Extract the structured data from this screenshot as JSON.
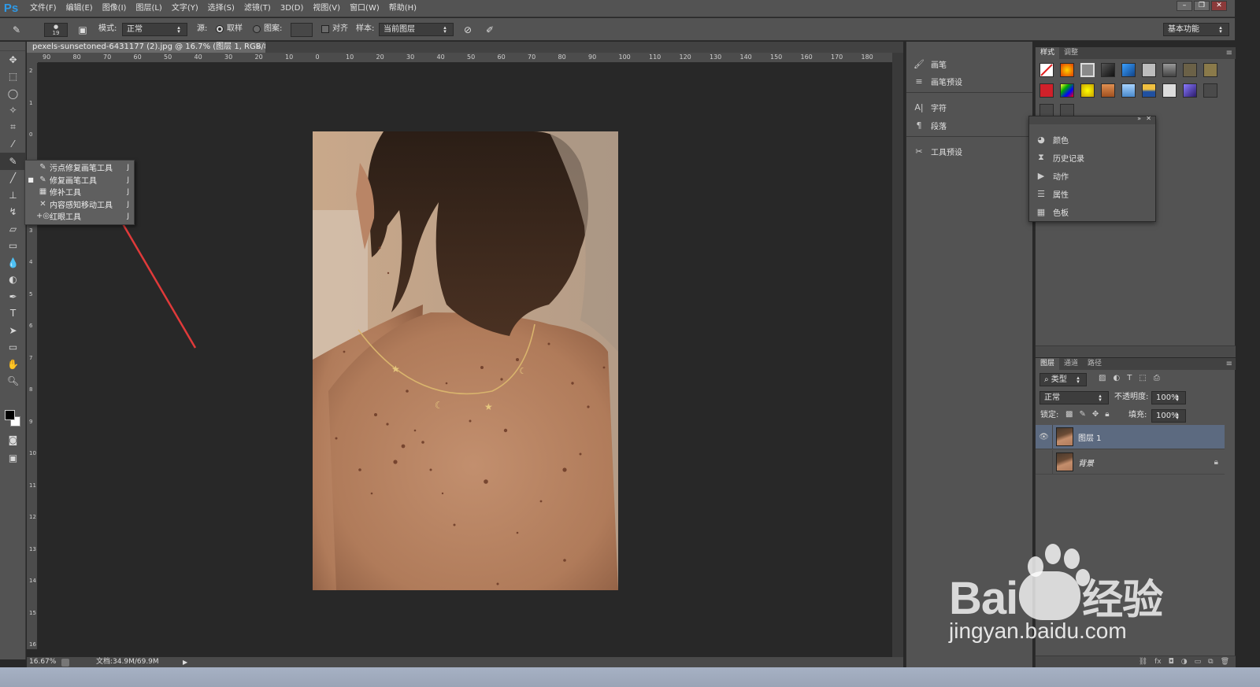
{
  "app": {
    "logo": "Ps"
  },
  "menu": [
    "文件(F)",
    "编辑(E)",
    "图像(I)",
    "图层(L)",
    "文字(Y)",
    "选择(S)",
    "滤镜(T)",
    "3D(D)",
    "视图(V)",
    "窗口(W)",
    "帮助(H)"
  ],
  "options": {
    "brush_size": "19",
    "mode_label": "模式:",
    "mode_value": "正常",
    "source_label": "源:",
    "sampled_label": "取样",
    "pattern_label": "图案:",
    "aligned_label": "对齐",
    "sample_label": "样本:",
    "sample_value": "当前图层",
    "workspace": "基本功能"
  },
  "document": {
    "tab_title": "pexels-sunsetoned-6431177 (2).jpg @ 16.7% (图层 1, RGB/8) *",
    "zoom": "16.67%",
    "doc_size": "文档:34.9M/69.9M"
  },
  "ruler": {
    "top_ticks": [
      "90",
      "80",
      "70",
      "60",
      "50",
      "40",
      "30",
      "20",
      "10",
      "0",
      "10",
      "20",
      "30",
      "40",
      "50",
      "60",
      "70",
      "80",
      "90",
      "100",
      "110",
      "120",
      "130",
      "140",
      "150",
      "160",
      "170",
      "180"
    ],
    "left_ticks": [
      "2",
      "1",
      "0",
      "1",
      "2",
      "3",
      "4",
      "5",
      "6",
      "7",
      "8",
      "9",
      "10",
      "11",
      "12",
      "13",
      "14",
      "15",
      "16"
    ]
  },
  "flyout": [
    {
      "label": "污点修复画笔工具",
      "key": "J",
      "icon": "spot-healing-icon",
      "active": false
    },
    {
      "label": "修复画笔工具",
      "key": "J",
      "icon": "healing-brush-icon",
      "active": true
    },
    {
      "label": "修补工具",
      "key": "J",
      "icon": "patch-icon",
      "active": false
    },
    {
      "label": "内容感知移动工具",
      "key": "J",
      "icon": "content-aware-move-icon",
      "active": false
    },
    {
      "label": "红眼工具",
      "key": "J",
      "icon": "red-eye-icon",
      "active": false
    }
  ],
  "panel_column": [
    {
      "label": "画笔",
      "icon": "brush-icon"
    },
    {
      "label": "画笔预设",
      "icon": "brush-presets-icon"
    },
    {
      "label": "字符",
      "icon": "character-icon"
    },
    {
      "label": "段落",
      "icon": "paragraph-icon"
    },
    {
      "label": "工具预设",
      "icon": "tool-presets-icon"
    }
  ],
  "styles_panel": {
    "tabs": [
      "样式",
      "调整"
    ]
  },
  "float_panel": [
    {
      "label": "颜色",
      "icon": "color-icon"
    },
    {
      "label": "历史记录",
      "icon": "history-icon"
    },
    {
      "label": "动作",
      "icon": "actions-icon"
    },
    {
      "label": "属性",
      "icon": "properties-icon"
    },
    {
      "label": "色板",
      "icon": "swatches-icon"
    }
  ],
  "layers_panel": {
    "tabs": [
      "图层",
      "通道",
      "路径"
    ],
    "filter_label": "类型",
    "blend_mode": "正常",
    "opacity_label": "不透明度:",
    "opacity_value": "100%",
    "lock_label": "锁定:",
    "fill_label": "填充:",
    "fill_value": "100%",
    "layers": [
      {
        "name": "图层 1",
        "visible": true,
        "selected": true,
        "locked": false
      },
      {
        "name": "背景",
        "visible": false,
        "selected": false,
        "locked": true
      }
    ]
  },
  "watermark": {
    "brand": "Bai",
    "brand2": "经验",
    "url": "jingyan.baidu.com"
  },
  "colors": {
    "accent": "#2e9ae8",
    "arrow": "#e03a3a",
    "selection": "#5c6a80"
  }
}
